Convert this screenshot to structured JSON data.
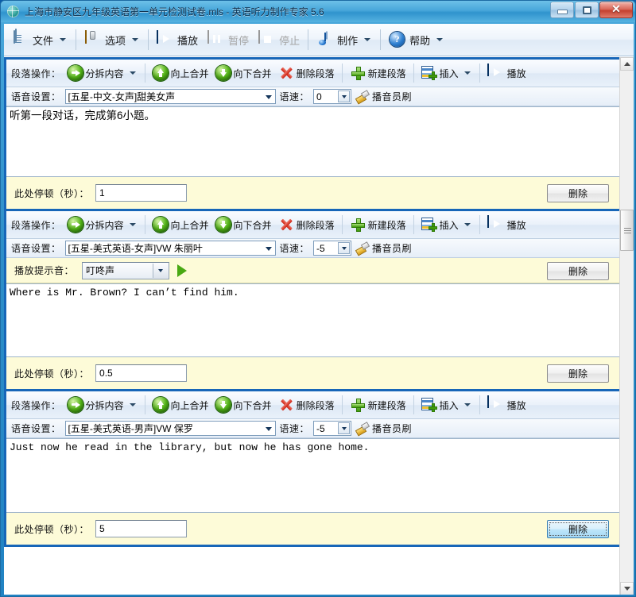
{
  "window": {
    "title": "上海市静安区九年级英语第一单元检测试卷.mls - 英语听力制作专家 5.6",
    "icon": "globe-icon",
    "controls": {
      "minimize": "–",
      "maximize": "□",
      "close": "✕"
    }
  },
  "toolbar": {
    "items": [
      {
        "label": "文件",
        "icon": "document-icon",
        "dropdown": true,
        "enabled": true
      },
      {
        "label": "选项",
        "icon": "gear-icon",
        "dropdown": true,
        "enabled": true
      },
      {
        "label": "播放",
        "icon": "play-icon",
        "dropdown": false,
        "enabled": true
      },
      {
        "label": "暂停",
        "icon": "pause-icon",
        "dropdown": false,
        "enabled": false
      },
      {
        "label": "停止",
        "icon": "stop-icon",
        "dropdown": false,
        "enabled": false
      },
      {
        "label": "制作",
        "icon": "music-note-icon",
        "dropdown": true,
        "enabled": true
      },
      {
        "label": "帮助",
        "icon": "help-icon",
        "dropdown": true,
        "enabled": true
      }
    ]
  },
  "paragraph_toolbar": {
    "label": "段落操作：",
    "actions": [
      {
        "label": "分拆内容",
        "icon": "split-arrow-icon",
        "dropdown": true
      },
      {
        "label": "向上合并",
        "icon": "arrow-up-icon",
        "dropdown": false
      },
      {
        "label": "向下合并",
        "icon": "arrow-down-icon",
        "dropdown": false
      },
      {
        "label": "删除段落",
        "icon": "red-x-icon",
        "dropdown": false
      },
      {
        "label": "新建段落",
        "icon": "green-plus-icon",
        "dropdown": false
      },
      {
        "label": "插入",
        "icon": "insert-table-icon",
        "dropdown": true
      },
      {
        "label": "播放",
        "icon": "play-icon",
        "dropdown": false
      }
    ]
  },
  "voice_row": {
    "label": "语音设置：",
    "speed_label": "语速：",
    "announcer_label": "播音员刷",
    "announcer_icon": "brush-icon"
  },
  "pause_row": {
    "label": "此处停顿（秒）：",
    "delete_label": "删除"
  },
  "hint_row": {
    "label": "播放提示音：",
    "preview_icon": "green-play-triangle-icon"
  },
  "paragraphs": [
    {
      "voice": "[五星-中文-女声]甜美女声",
      "speed": "0",
      "text": "听第一段对话，完成第6小题。",
      "text_lang": "cn",
      "pause": "1",
      "has_hint_sound": false,
      "hint_sound": "",
      "delete_focused": false
    },
    {
      "voice": "[五星-美式英语-女声]VW 朱丽叶",
      "speed": "-5",
      "text": "Where is Mr. Brown? I can’t find him.",
      "text_lang": "en",
      "pause": "0.5",
      "has_hint_sound": true,
      "hint_sound": "叮咚声",
      "delete_focused": false
    },
    {
      "voice": "[五星-美式英语-男声]VW 保罗",
      "speed": "-5",
      "text": "Just now he read in the library, but now he has gone home.",
      "text_lang": "en",
      "pause": "5",
      "has_hint_sound": false,
      "hint_sound": "",
      "delete_focused": true
    }
  ],
  "scrollbar": {
    "up_arrow": "▲",
    "down_arrow": "▼"
  },
  "colors": {
    "accent": "#1766b8",
    "titlebar": "#48a7da",
    "pause_bg": "#fdfbd8"
  }
}
